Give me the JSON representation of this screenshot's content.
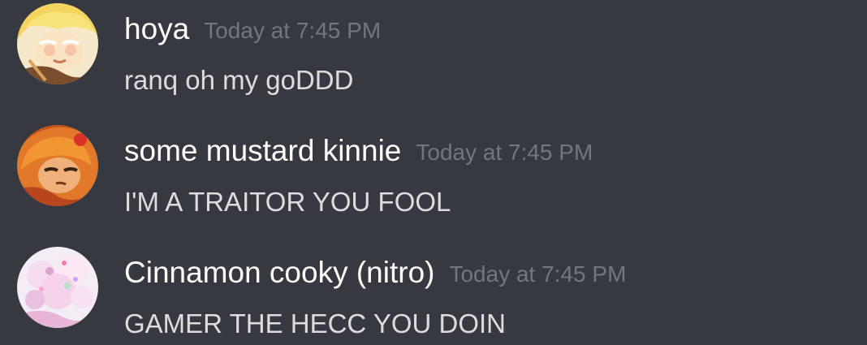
{
  "messages": [
    {
      "username": "hoya",
      "timestamp": "Today at 7:45 PM",
      "content": "ranq oh my goDDD",
      "avatar_icon": "cookie-character-avatar-yellow"
    },
    {
      "username": "some mustard kinnie",
      "timestamp": "Today at 7:45 PM",
      "content": "I'M A TRAITOR YOU FOOL",
      "avatar_icon": "cookie-character-avatar-orange"
    },
    {
      "username": "Cinnamon cooky (nitro)",
      "timestamp": "Today at 7:45 PM",
      "content": "GAMER THE HECC YOU DOIN",
      "avatar_icon": "cookie-character-avatar-pink"
    }
  ],
  "colors": {
    "background": "#36393f",
    "username": "#ffffff",
    "timestamp": "#72767d",
    "content": "#dcddde"
  }
}
